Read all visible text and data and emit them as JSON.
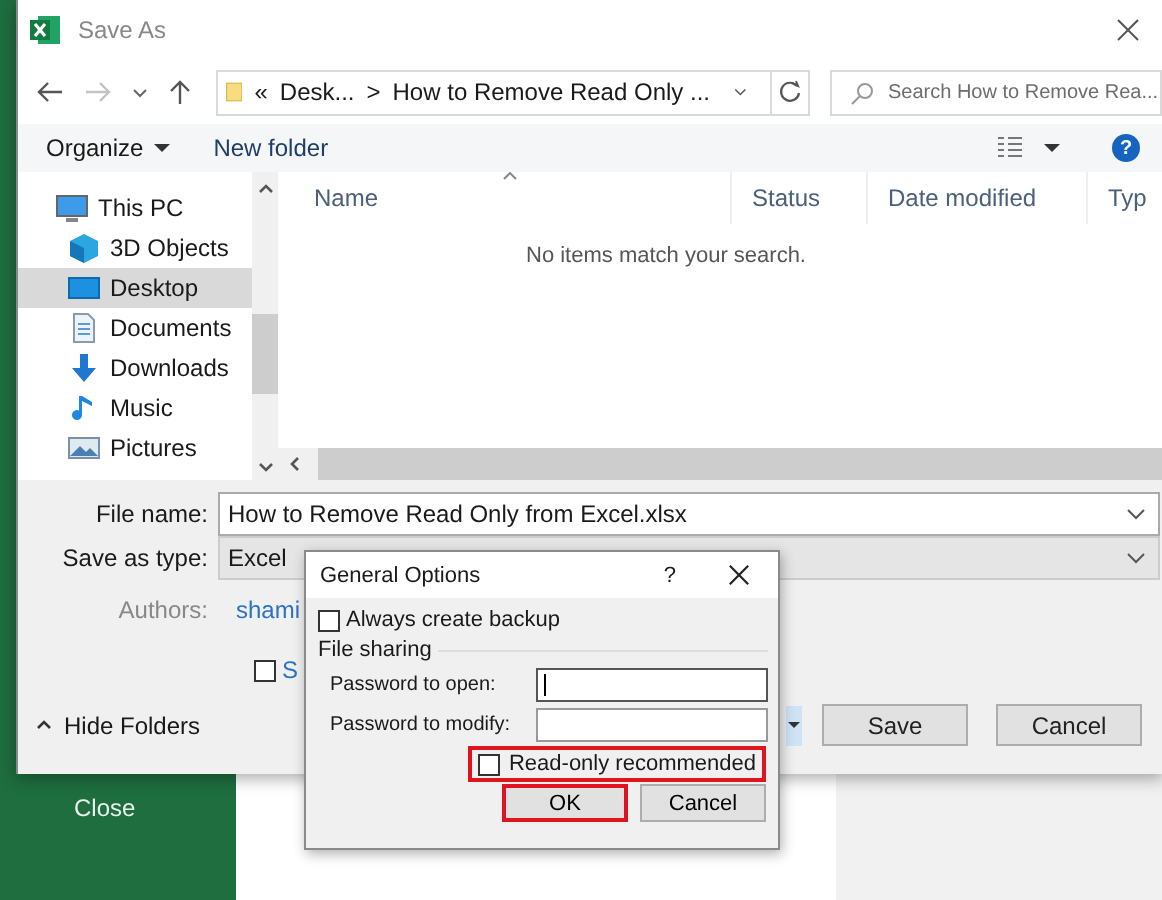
{
  "backstage": {
    "close": "Close"
  },
  "window": {
    "title": "Save As"
  },
  "nav": {
    "forward_enabled": false
  },
  "address": {
    "overflow": "«",
    "path": [
      "Desk...",
      "How to Remove Read Only ..."
    ],
    "separator": ">"
  },
  "search": {
    "placeholder": "Search How to Remove Rea..."
  },
  "toolbar": {
    "organize": "Organize",
    "new_folder": "New folder",
    "help": "?"
  },
  "sidebar": {
    "items": [
      {
        "label": "This PC",
        "selected": false,
        "children": [
          {
            "label": "3D Objects",
            "selected": false
          },
          {
            "label": "Desktop",
            "selected": true
          },
          {
            "label": "Documents",
            "selected": false
          },
          {
            "label": "Downloads",
            "selected": false
          },
          {
            "label": "Music",
            "selected": false
          },
          {
            "label": "Pictures",
            "selected": false
          }
        ]
      }
    ]
  },
  "file_list": {
    "columns": [
      "Name",
      "Status",
      "Date modified",
      "Typ"
    ],
    "empty_message": "No items match your search."
  },
  "form": {
    "file_name": {
      "label": "File name:",
      "value": "How to Remove Read Only from Excel.xlsx"
    },
    "save_as_type": {
      "label": "Save as type:",
      "value": "Excel"
    },
    "authors": {
      "label": "Authors:",
      "value": "shami"
    },
    "option_checkbox": {
      "label": "S",
      "checked": false
    }
  },
  "hide_folders": "Hide Folders",
  "buttons": [
    {
      "label": "Save"
    },
    {
      "label": "Cancel"
    }
  ],
  "dialog": {
    "title": "General Options",
    "help": "?",
    "always_backup": {
      "label": "Always create backup",
      "checked": false
    },
    "group": "File sharing",
    "fields": [
      {
        "label": "Password to open:",
        "focused": true
      },
      {
        "label": "Password to modify:",
        "focused": false
      }
    ],
    "read_only": {
      "label": "Read-only recommended",
      "checked": false,
      "highlighted": true
    },
    "buttons": [
      {
        "label": "OK",
        "highlighted": true
      },
      {
        "label": "Cancel",
        "highlighted": false
      }
    ]
  }
}
